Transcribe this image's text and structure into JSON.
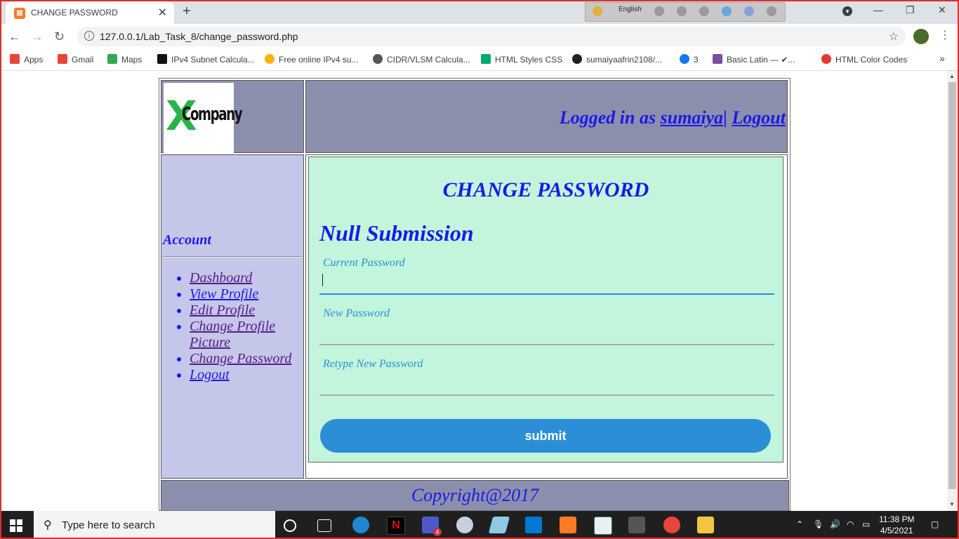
{
  "browser": {
    "tab_title": "CHANGE PASSWORD",
    "language": "English",
    "url": "127.0.0.1/Lab_Task_8/change_password.php"
  },
  "bookmarks": [
    {
      "label": "Apps",
      "color": "#e8453c"
    },
    {
      "label": "Gmail",
      "color": "#ea4335"
    },
    {
      "label": "Maps",
      "color": "#34a853"
    },
    {
      "label": "IPv4 Subnet Calcula...",
      "color": "#111111"
    },
    {
      "label": "Free online IPv4 su...",
      "color": "#f4b400"
    },
    {
      "label": "CIDR/VLSM Calcula...",
      "color": "#555555"
    },
    {
      "label": "HTML Styles CSS",
      "color": "#04aa6d"
    },
    {
      "label": "sumaiyaafrin2108/...",
      "color": "#222222"
    },
    {
      "label": "3",
      "color": "#1877f2"
    },
    {
      "label": "Basic Latin — ✔...",
      "color": "#7b4ea3"
    },
    {
      "label": "HTML Color Codes",
      "color": "#e53935"
    }
  ],
  "header": {
    "logo_x": "X",
    "logo_word": "Company",
    "logged_in_prefix": "Logged in as",
    "username": "sumaiya",
    "separator": "|",
    "logout": "Logout"
  },
  "sidebar": {
    "title": "Account",
    "items": [
      {
        "label": "Dashboard"
      },
      {
        "label": "View Profile"
      },
      {
        "label": "Edit Profile"
      },
      {
        "label": "Change Profile Picture"
      },
      {
        "label": "Change Password"
      },
      {
        "label": "Logout"
      }
    ]
  },
  "form": {
    "title": "CHANGE PASSWORD",
    "error": "Null Submission",
    "fields": [
      {
        "label": "Current Password",
        "value": ""
      },
      {
        "label": "New Password",
        "value": ""
      },
      {
        "label": "Retype New Password",
        "value": ""
      }
    ],
    "submit": "submit"
  },
  "footer": {
    "text": "Copyright@2017"
  },
  "taskbar": {
    "search_placeholder": "Type here to search",
    "time": "11:38 PM",
    "date": "4/5/2021",
    "teams_badge": "4"
  },
  "colors": {
    "header_bg": "#8c8fac",
    "sidebar_bg": "#c5c7e8",
    "form_bg": "#c2f5dc",
    "accent": "#2c8ed6",
    "text_blue": "#1a1ae6"
  }
}
